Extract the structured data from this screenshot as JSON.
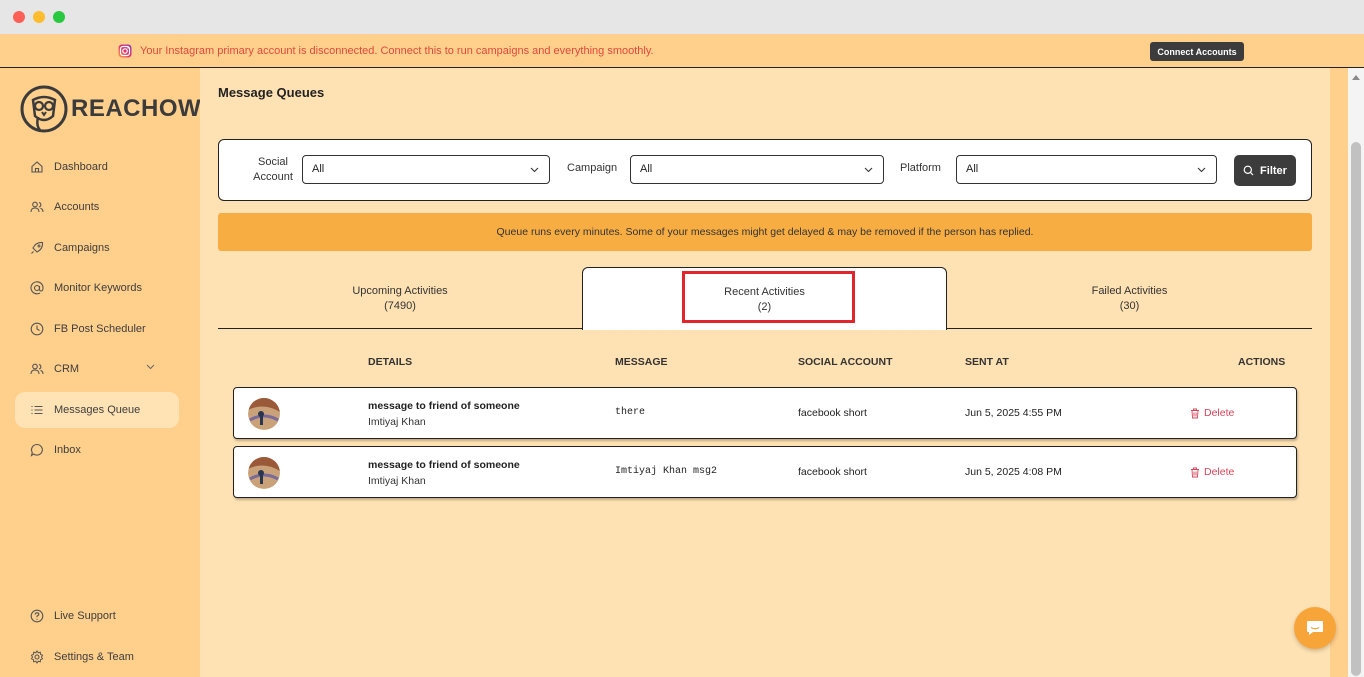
{
  "banner": {
    "message": "Your Instagram primary account is disconnected. Connect this to run campaigns and everything smoothly.",
    "connect_label": "Connect Accounts"
  },
  "logo": {
    "text": "REACHOWL"
  },
  "sidebar": {
    "items": [
      {
        "label": "Dashboard",
        "icon": "home-icon"
      },
      {
        "label": "Accounts",
        "icon": "users-icon"
      },
      {
        "label": "Campaigns",
        "icon": "rocket-icon"
      },
      {
        "label": "Monitor Keywords",
        "icon": "at-icon"
      },
      {
        "label": "FB Post Scheduler",
        "icon": "clock-icon"
      },
      {
        "label": "CRM",
        "icon": "users-icon"
      },
      {
        "label": "Messages Queue",
        "icon": "list-icon",
        "active": true
      },
      {
        "label": "Inbox",
        "icon": "chat-icon"
      }
    ],
    "bottom": [
      {
        "label": "Live Support",
        "icon": "help-icon"
      },
      {
        "label": "Settings & Team",
        "icon": "gear-icon"
      }
    ]
  },
  "page": {
    "title": "Message Queues"
  },
  "filters": {
    "social_account_label": "Social Account",
    "social_account_value": "All",
    "campaign_label": "Campaign",
    "campaign_value": "All",
    "platform_label": "Platform",
    "platform_value": "All",
    "filter_label": "Filter"
  },
  "notice": "Queue runs every minutes. Some of your messages might get delayed & may be removed if the person has replied.",
  "tabs": [
    {
      "label": "Upcoming Activities",
      "count": "(7490)"
    },
    {
      "label": "Recent Activities",
      "count": "(2)",
      "active": true
    },
    {
      "label": "Failed Activities",
      "count": "(30)"
    }
  ],
  "table": {
    "headers": [
      "DETAILS",
      "MESSAGE",
      "SOCIAL ACCOUNT",
      "SENT AT",
      "ACTIONS"
    ],
    "rows": [
      {
        "title": "message to friend of someone",
        "name": "Imtiyaj Khan",
        "message": "there",
        "account": "facebook short",
        "sent_at": "Jun 5, 2025 4:55 PM",
        "action": "Delete"
      },
      {
        "title": "message to friend of someone",
        "name": "Imtiyaj Khan",
        "message": "Imtiyaj Khan msg2",
        "account": "facebook short",
        "sent_at": "Jun 5, 2025 4:08 PM",
        "action": "Delete"
      }
    ]
  },
  "colors": {
    "accent": "#f8ad43",
    "sidebar": "#ffcf8c",
    "main": "#ffe2b3",
    "danger": "#d4445a",
    "highlight": "#e0262b"
  }
}
